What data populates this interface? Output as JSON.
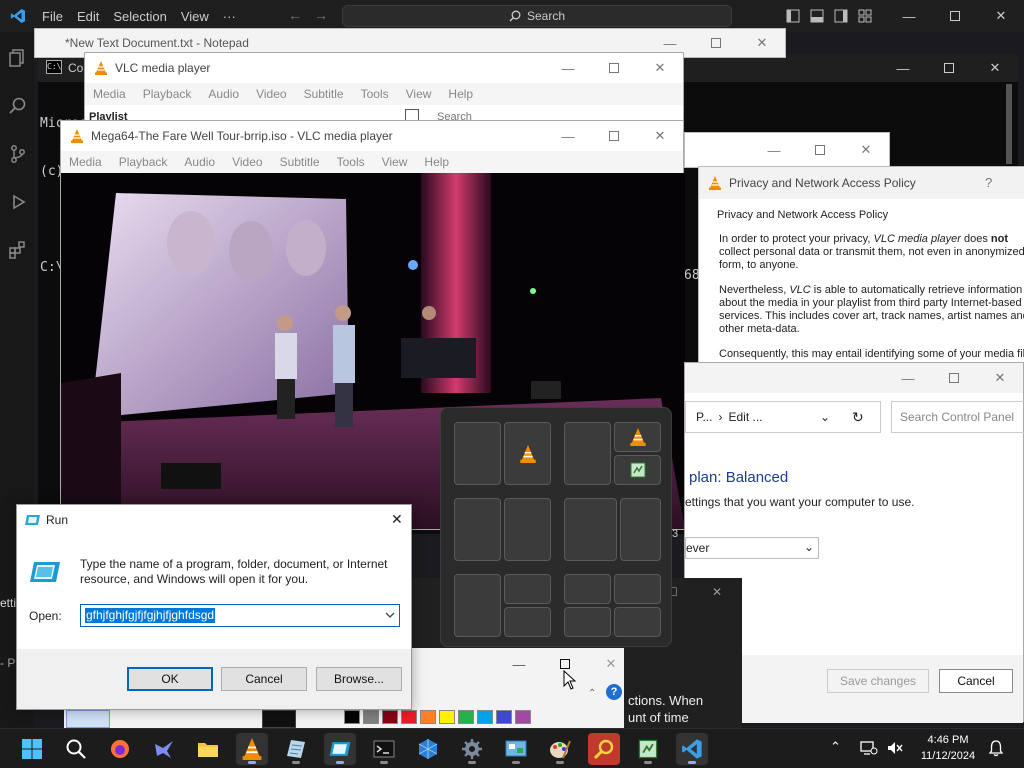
{
  "vscode": {
    "menu": [
      "File",
      "Edit",
      "Selection",
      "View",
      "···"
    ],
    "search_label": "Search"
  },
  "notepad": {
    "title": "*New Text Document.txt - Notepad"
  },
  "cmd": {
    "title": "Co",
    "lines": [
      "Micros",
      "(c) Mi",
      "",
      "C:\\"
    ],
    "frag": "68"
  },
  "vlc_back": {
    "title": "VLC media player",
    "menu": [
      "Media",
      "Playback",
      "Audio",
      "Video",
      "Subtitle",
      "Tools",
      "View",
      "Help"
    ],
    "playlist_label": "Playlist",
    "search_placeholder": "Search"
  },
  "vlc_front": {
    "title": "Mega64-The Fare Well Tour-brrip.iso - VLC media player",
    "menu": [
      "Media",
      "Playback",
      "Audio",
      "Video",
      "Subtitle",
      "Tools",
      "View",
      "Help"
    ]
  },
  "privacy": {
    "title": "Privacy and Network Access Policy",
    "help": "?",
    "group_label": "Privacy and Network Access Policy",
    "p1_a": "In order to protect your privacy, ",
    "p1_vlc": "VLC media player",
    "p1_b": " does ",
    "p1_not": "not",
    "p1_c": " collect personal data or transmit them, not even in anonymized form, to anyone.",
    "p2_a": "Nevertheless, ",
    "p2_vlc": "VLC",
    "p2_b": " is able to automatically retrieve information about the media in your playlist from third party Internet-based services. This includes cover art, track names, artist names and other meta-data.",
    "p3": "Consequently, this may entail identifying some of your media fil"
  },
  "cpanel": {
    "breadcrumb_prefix": "P...",
    "breadcrumb_current": "Edit ...",
    "search_placeholder": "Search Control Panel",
    "plan_title": "plan: Balanced",
    "subtitle": "ettings that you want your computer to use.",
    "select_value": "ever",
    "frag": "3",
    "save_label": "Save changes",
    "cancel_label": "Cancel"
  },
  "dark_dialog": {
    "line1": "ctions. When",
    "line2": "unt of time"
  },
  "left_frags": {
    "a": "etti",
    "b": "- Pa"
  },
  "run": {
    "title": "Run",
    "description": "Type the name of a program, folder, document, or Internet resource, and Windows will open it for you.",
    "open_label": "Open:",
    "open_value": "gfhjfghjfgjfjfgjhjfjghfdsgd",
    "ok_label": "OK",
    "cancel_label": "Cancel",
    "browse_label": "Browse..."
  },
  "taskbar": {
    "time": "4:46 PM",
    "date": "11/12/2024"
  },
  "colors": {
    "accent": "#0067c0",
    "vlc_orange": "#f08c00",
    "taskbar": "#1c1c1c",
    "selection": "#0078d7"
  },
  "icons": [
    "windows-start-icon",
    "search-icon",
    "firefox-icon",
    "bird-app-icon",
    "file-explorer-icon",
    "vlc-icon",
    "notepad-icon",
    "remote-desktop-icon",
    "terminal-icon",
    "cube-app-icon",
    "settings-gear-icon",
    "control-panel-icon",
    "paint-icon",
    "magnifier-icon",
    "notepad-plus-icon",
    "vscode-icon"
  ]
}
